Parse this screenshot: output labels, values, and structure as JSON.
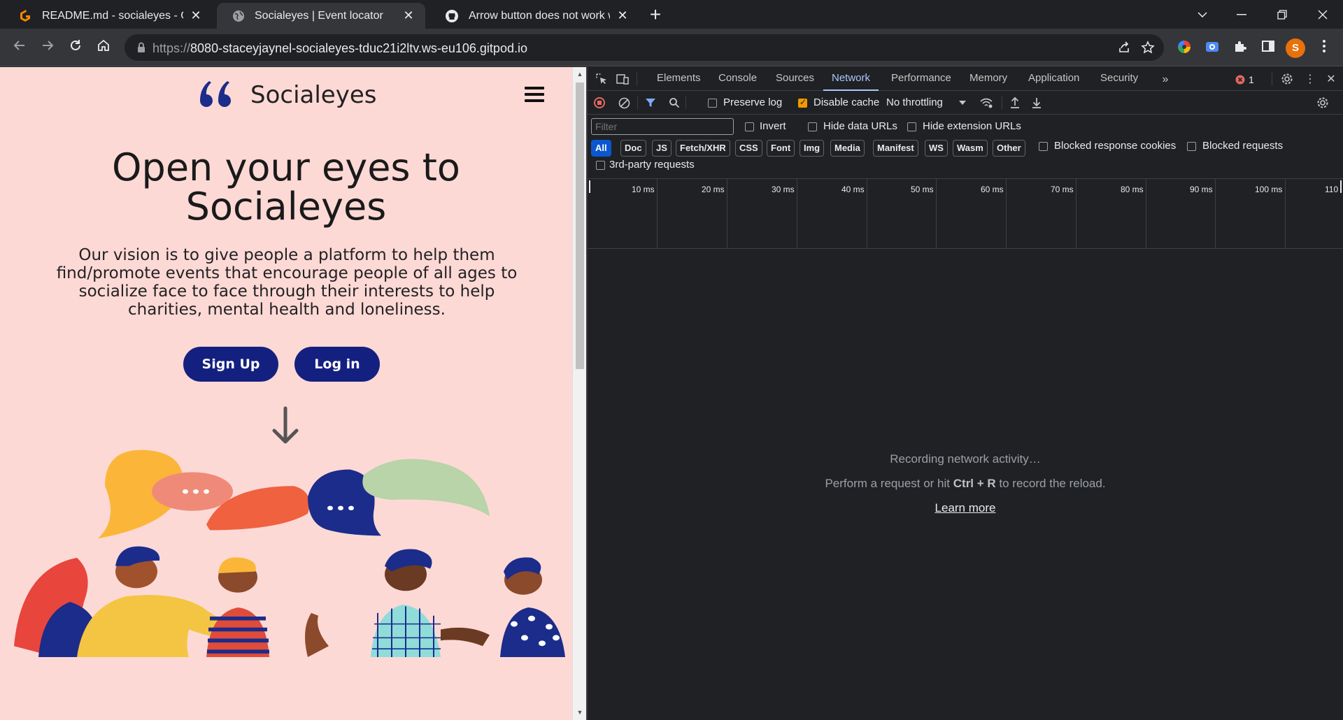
{
  "tabs": [
    {
      "title": "README.md - socialeyes - Gitpod",
      "active": false,
      "icon": "gitpod-icon"
    },
    {
      "title": "Socialeyes | Event locator",
      "active": true,
      "icon": "globe-icon"
    },
    {
      "title": "Arrow button does not work wh",
      "active": false,
      "icon": "github-icon"
    }
  ],
  "address": {
    "scheme": "https://",
    "host": "8080-staceyjaynel-socialeyes-tduc21i2ltv.ws-eu106.gitpod.io"
  },
  "profile": {
    "initial": "S",
    "color": "#e8710a"
  },
  "site": {
    "brand_mark": "66",
    "brand_name": "Socialeyes",
    "hero_title_line1": "Open your eyes to",
    "hero_title_line2": "Socialeyes",
    "hero_subtitle": "Our vision is to give people a platform to help them find/promote events that encourage people of all ages to socialize face to face through their interests to help charities, mental health and loneliness.",
    "signup_label": "Sign Up",
    "login_label": "Log in",
    "accent": "#142080",
    "background": "#fdd9d6"
  },
  "devtools": {
    "tabs": [
      "Elements",
      "Console",
      "Sources",
      "Network",
      "Performance",
      "Memory",
      "Application",
      "Security"
    ],
    "active_tab": "Network",
    "error_count": "1",
    "preserve_log": "Preserve log",
    "disable_cache": "Disable cache",
    "throttling": "No throttling",
    "filter_placeholder": "Filter",
    "invert": "Invert",
    "hide_data_urls": "Hide data URLs",
    "hide_extension_urls": "Hide extension URLs",
    "type_filters": [
      "All",
      "Doc",
      "JS",
      "Fetch/XHR",
      "CSS",
      "Font",
      "Img",
      "Media",
      "Manifest",
      "WS",
      "Wasm",
      "Other"
    ],
    "blocked_response_cookies": "Blocked response cookies",
    "blocked_requests": "Blocked requests",
    "third_party": "3rd-party requests",
    "timeline_ticks": [
      "10 ms",
      "20 ms",
      "30 ms",
      "40 ms",
      "50 ms",
      "60 ms",
      "70 ms",
      "80 ms",
      "90 ms",
      "100 ms",
      "110"
    ],
    "recording": "Recording network activity…",
    "hint_prefix": "Perform a request or hit ",
    "hint_shortcut": "Ctrl + R",
    "hint_suffix": " to record the reload.",
    "learn_more": "Learn more"
  }
}
